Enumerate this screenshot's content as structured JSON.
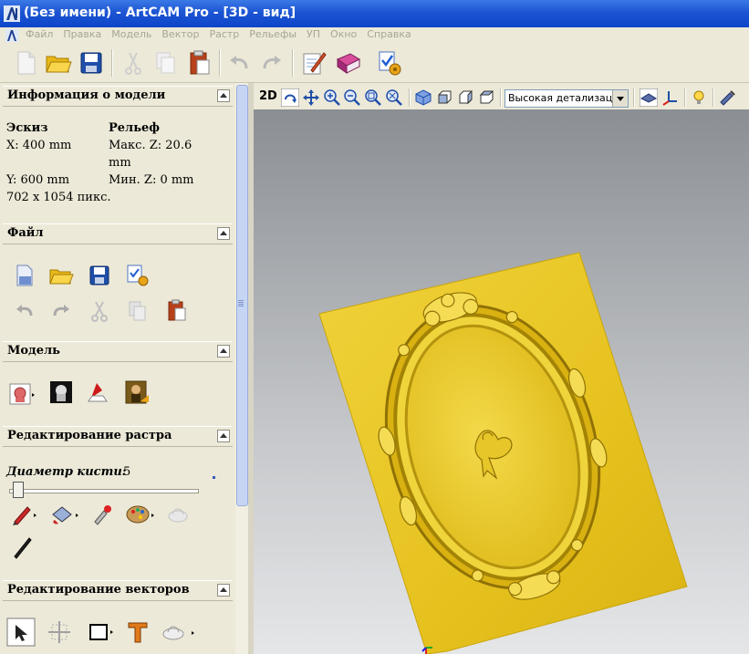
{
  "window": {
    "title": "(Без имени) - ArtCAM Pro - [3D - вид]"
  },
  "menu": {
    "items": [
      "Файл",
      "Правка",
      "Модель",
      "Вектор",
      "Растр",
      "Рельефы",
      "УП",
      "Окно",
      "Справка"
    ]
  },
  "toolbar": {
    "icons": [
      "new-file-icon",
      "open-folder-icon",
      "save-icon",
      "cut-icon",
      "copy-icon",
      "paste-icon",
      "undo-icon",
      "redo-icon",
      "edit-notes-icon",
      "help-book-icon",
      "wizard-icon"
    ]
  },
  "model_info": {
    "header": "Информация о модели",
    "sketch_label": "Эскиз",
    "relief_label": "Рельеф",
    "x": "X: 400 mm",
    "max_z_1": "Макс. Z: 20.6",
    "max_z_2": "mm",
    "y": "Y: 600 mm",
    "min_z": "Мин. Z: 0 mm",
    "pixels": "702 x 1054 пикс."
  },
  "file_section": {
    "header": "Файл"
  },
  "model_section": {
    "header": "Модель"
  },
  "raster_section": {
    "header": "Редактирование растра",
    "brush_label": "Диаметр кисти:",
    "brush_value": "5"
  },
  "vector_section": {
    "header": "Редактирование векторов"
  },
  "view_toolbar": {
    "mode_2d": "2D",
    "detail_value": "Высокая детализация"
  },
  "colors": {
    "relief": "#e6c21f",
    "relief_dark": "#b4930e",
    "titlebar": "#0c45c8"
  }
}
